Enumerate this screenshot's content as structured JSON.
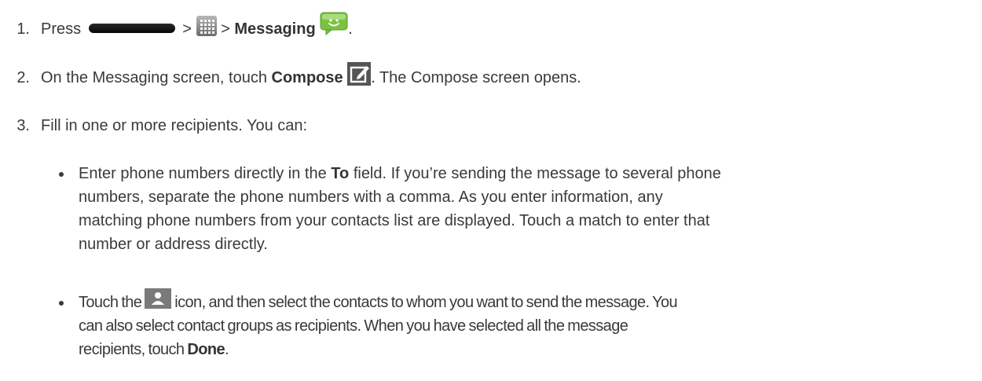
{
  "steps": [
    {
      "number": "1.",
      "text_press": "Press",
      "sep1": ">",
      "sep2": ">",
      "bold_messaging": "Messaging",
      "end": "."
    },
    {
      "number": "2.",
      "text_before": "On the Messaging screen, touch",
      "bold_compose": "Compose",
      "text_after": ". The Compose screen opens."
    },
    {
      "number": "3.",
      "text": "Fill in one or more recipients. You can:"
    }
  ],
  "bullets": [
    {
      "line1_before": "Enter phone numbers directly in the",
      "line1_bold": "To",
      "line1_after": "field. If you’re sending the message to several phone",
      "line2": "numbers, separate the phone numbers with a comma. As you enter information, any",
      "line3": "matching phone numbers from your contacts list are displayed. Touch a match to enter that",
      "line4": "number or address directly."
    },
    {
      "line1_before": "Touch the",
      "line1_after": "icon, and then select the contacts to whom you want to send the message. You",
      "line2": "can also select contact groups as recipients. When you have selected all the message",
      "line3_before": "recipients, touch",
      "line3_bold": "Done",
      "line3_end": "."
    }
  ],
  "icons": {
    "home_key": "home-key-icon",
    "apps": "apps-grid-icon",
    "messaging": "messaging-icon",
    "compose": "compose-icon",
    "contact": "contact-icon"
  },
  "colors": {
    "text": "#3a3a3a",
    "messaging_green": "#7cc242",
    "icon_gray": "#555555"
  }
}
